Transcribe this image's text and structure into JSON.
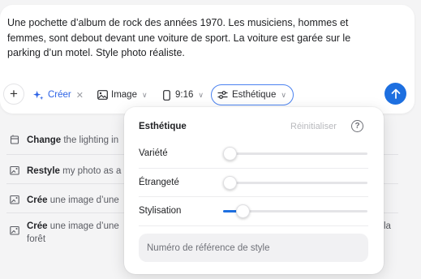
{
  "prompt": {
    "text": "Une pochette d’album de rock des années 1970. Les musiciens, hommes et femmes, sont debout devant une voiture de sport. La voiture est garée sur le parking d’un motel. Style photo réaliste."
  },
  "toolbar": {
    "add_icon": "plus-icon",
    "mode_label": "Créer",
    "mode_icon": "sparkle-icon",
    "mode_remove_icon": "close-icon",
    "type_label": "Image",
    "type_icon": "image-icon",
    "ratio_label": "9:16",
    "ratio_icon": "phone-portrait-icon",
    "aesthetic_label": "Esthétique",
    "aesthetic_icon": "sliders-icon",
    "submit_icon": "arrow-up-icon"
  },
  "suggestions": [
    {
      "verb": "Change",
      "rest": " the lighting in",
      "icon": "lighting-icon"
    },
    {
      "verb": "Restyle",
      "rest": " my photo as a",
      "icon": "image-edit-icon"
    },
    {
      "verb": "Crée",
      "rest": " une image d’une",
      "icon": "image-edit-icon"
    },
    {
      "verb": "Crée",
      "rest": " une image d’une",
      "tail": "la",
      "line2": "forêt",
      "icon": "image-edit-icon"
    }
  ],
  "aesthetic_panel": {
    "title": "Esthétique",
    "reset_label": "Réinitialiser",
    "help_icon": "help-circle-icon",
    "sliders": [
      {
        "label": "Variété",
        "value": 0.0
      },
      {
        "label": "Étrangeté",
        "value": 0.0
      },
      {
        "label": "Stylisation",
        "value": 0.14
      }
    ],
    "style_reference": {
      "value": "",
      "placeholder": "Numéro de référence de style"
    }
  },
  "colors": {
    "accent": "#1d6fe0",
    "accent_border": "#4b82f0",
    "mode_text": "#2d63e6",
    "background": "#f4f4f5"
  }
}
